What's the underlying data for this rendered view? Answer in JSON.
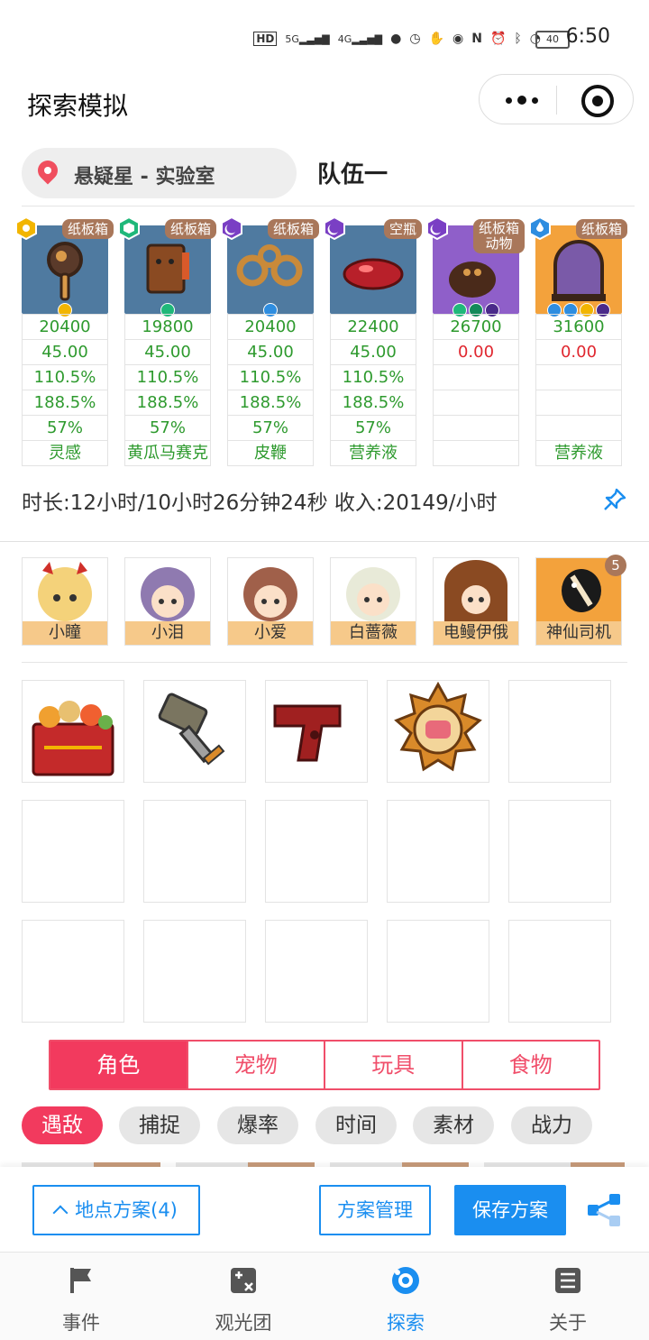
{
  "status_bar": {
    "time": "6:50",
    "battery": "40",
    "network_1": "5G",
    "network_2": "4G",
    "hd": "HD"
  },
  "header": {
    "title": "探索模拟"
  },
  "location": {
    "label": "悬疑星 - 实验室"
  },
  "team": {
    "name": "队伍一"
  },
  "slots": [
    {
      "tag": "纸板箱",
      "tag2": "",
      "values": [
        "20400",
        "45.00",
        "110.5%",
        "188.5%",
        "57%",
        "灵感"
      ],
      "badge_color": "#f2b500",
      "bg": "#4f7aa0"
    },
    {
      "tag": "纸板箱",
      "tag2": "",
      "values": [
        "19800",
        "45.00",
        "110.5%",
        "188.5%",
        "57%",
        "黄瓜马赛克"
      ],
      "badge_color": "#1fb87a",
      "bg": "#4f7aa0"
    },
    {
      "tag": "纸板箱",
      "tag2": "",
      "values": [
        "20400",
        "45.00",
        "110.5%",
        "188.5%",
        "57%",
        "皮鞭"
      ],
      "badge_color": "#7a3fc4",
      "bg": "#4f7aa0"
    },
    {
      "tag": "空瓶",
      "tag2": "",
      "values": [
        "22400",
        "45.00",
        "110.5%",
        "188.5%",
        "57%",
        "营养液"
      ],
      "badge_color": "#7a3fc4",
      "bg": "#4f7aa0"
    },
    {
      "tag": "纸板箱",
      "tag2": "动物",
      "values": [
        "26700",
        "0.00",
        "",
        "",
        "",
        ""
      ],
      "badge_color": "#7a3fc4",
      "bg": "#8f5fc9"
    },
    {
      "tag": "纸板箱",
      "tag2": "",
      "values": [
        "31600",
        "0.00",
        "",
        "",
        "",
        "营养液"
      ],
      "badge_color": "#2e8de0",
      "bg": "#f3a23c"
    }
  ],
  "summary": {
    "text": "时长:12小时/10小时26分钟24秒 收入:20149/小时"
  },
  "members": [
    {
      "name": "小瞳"
    },
    {
      "name": "小泪"
    },
    {
      "name": "小爱"
    },
    {
      "name": "白蔷薇"
    },
    {
      "name": "电鳗伊俄"
    },
    {
      "name": "神仙司机",
      "count": "5"
    }
  ],
  "category_tabs": [
    "角色",
    "宠物",
    "玩具",
    "食物"
  ],
  "filter_chips": [
    "遇敌",
    "捕捉",
    "爆率",
    "时间",
    "素材",
    "战力"
  ],
  "actions": {
    "location_plan": "地点方案(4)",
    "plan_manage": "方案管理",
    "save_plan": "保存方案"
  },
  "tabbar": [
    {
      "label": "事件",
      "icon": "flag-icon"
    },
    {
      "label": "观光团",
      "icon": "calculator-icon"
    },
    {
      "label": "探索",
      "icon": "explore-icon"
    },
    {
      "label": "关于",
      "icon": "list-icon"
    }
  ],
  "colors": {
    "accent_blue": "#1a8ef0",
    "accent_red": "#f23a5e",
    "stat_green": "#2e9a2e",
    "stat_red": "#e0272f",
    "tag_brown": "#a9775a"
  }
}
